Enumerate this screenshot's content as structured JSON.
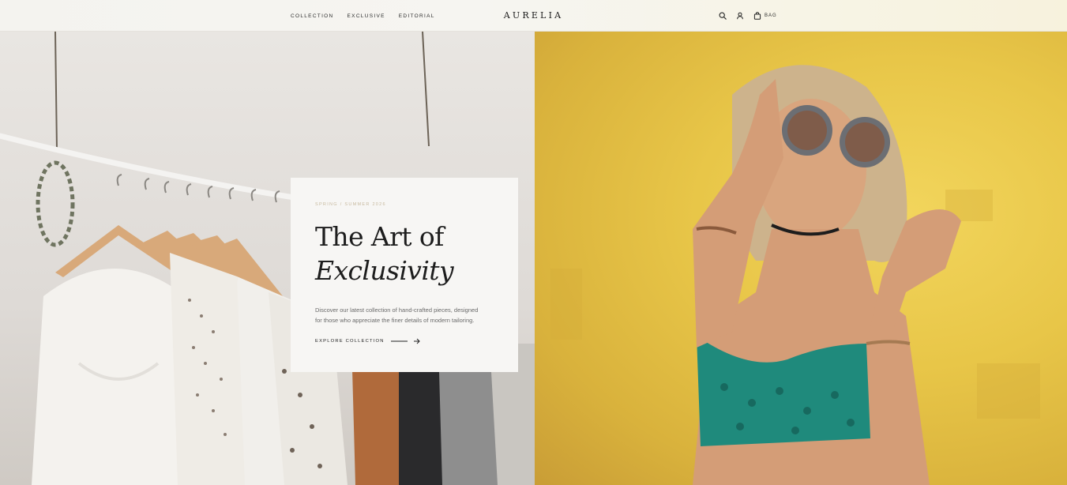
{
  "header": {
    "nav": [
      {
        "label": "COLLECTION"
      },
      {
        "label": "EXCLUSIVE"
      },
      {
        "label": "EDITORIAL"
      }
    ],
    "brand": "AURELIA",
    "actions": {
      "search_icon": "search-icon",
      "account_icon": "user-icon",
      "bag_icon": "bag-icon",
      "bag_label": "BAG"
    }
  },
  "hero": {
    "left_image": "clothing-rack-photo",
    "right_image": "woman-sunglasses-yellow-wall-photo",
    "card": {
      "eyebrow": "SPRING / SUMMER 2026",
      "headline_line1": "The Art of",
      "headline_line2": "Exclusivity",
      "description": "Discover our latest collection of hand-crafted pieces, designed for those who appreciate the finer details of modern tailoring.",
      "cta_label": "EXPLORE COLLECTION",
      "cta_icon": "arrow-right-icon"
    }
  },
  "colors": {
    "text_dark": "#1d1d1d",
    "eyebrow": "#c7b99e",
    "card_bg": "#f7f6f4",
    "right_wall": "#e8c648",
    "top_teal": "#1f8a7c"
  }
}
